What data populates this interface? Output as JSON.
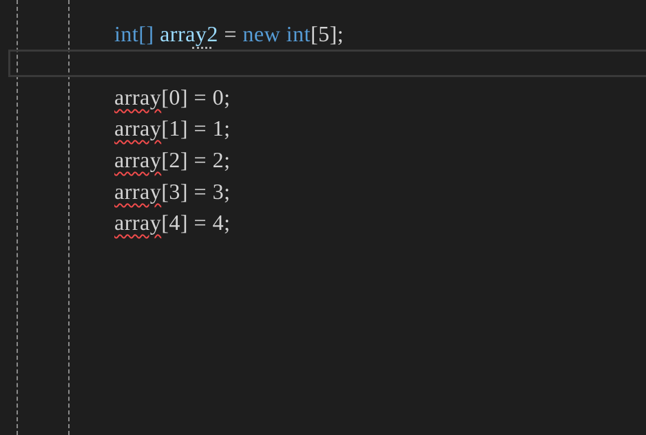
{
  "editor": {
    "line_decl": {
      "type_kw": "int[]",
      "var_name": "array2",
      "assign": "=",
      "new_kw": "new",
      "elem_kw": "int",
      "size_expr": "[5];"
    },
    "assignments": [
      {
        "name": "array",
        "rest": "[0] = 0;"
      },
      {
        "name": "array",
        "rest": "[1] = 1;"
      },
      {
        "name": "array",
        "rest": "[2] = 2;"
      },
      {
        "name": "array",
        "rest": "[3] = 3;"
      },
      {
        "name": "array",
        "rest": "[4] = 4;"
      }
    ]
  },
  "colors": {
    "background": "#1e1e1e",
    "keyword": "#569cd6",
    "identifier": "#9cdcfe",
    "text": "#d4d4d4",
    "error_squiggle": "#f14c4c"
  }
}
